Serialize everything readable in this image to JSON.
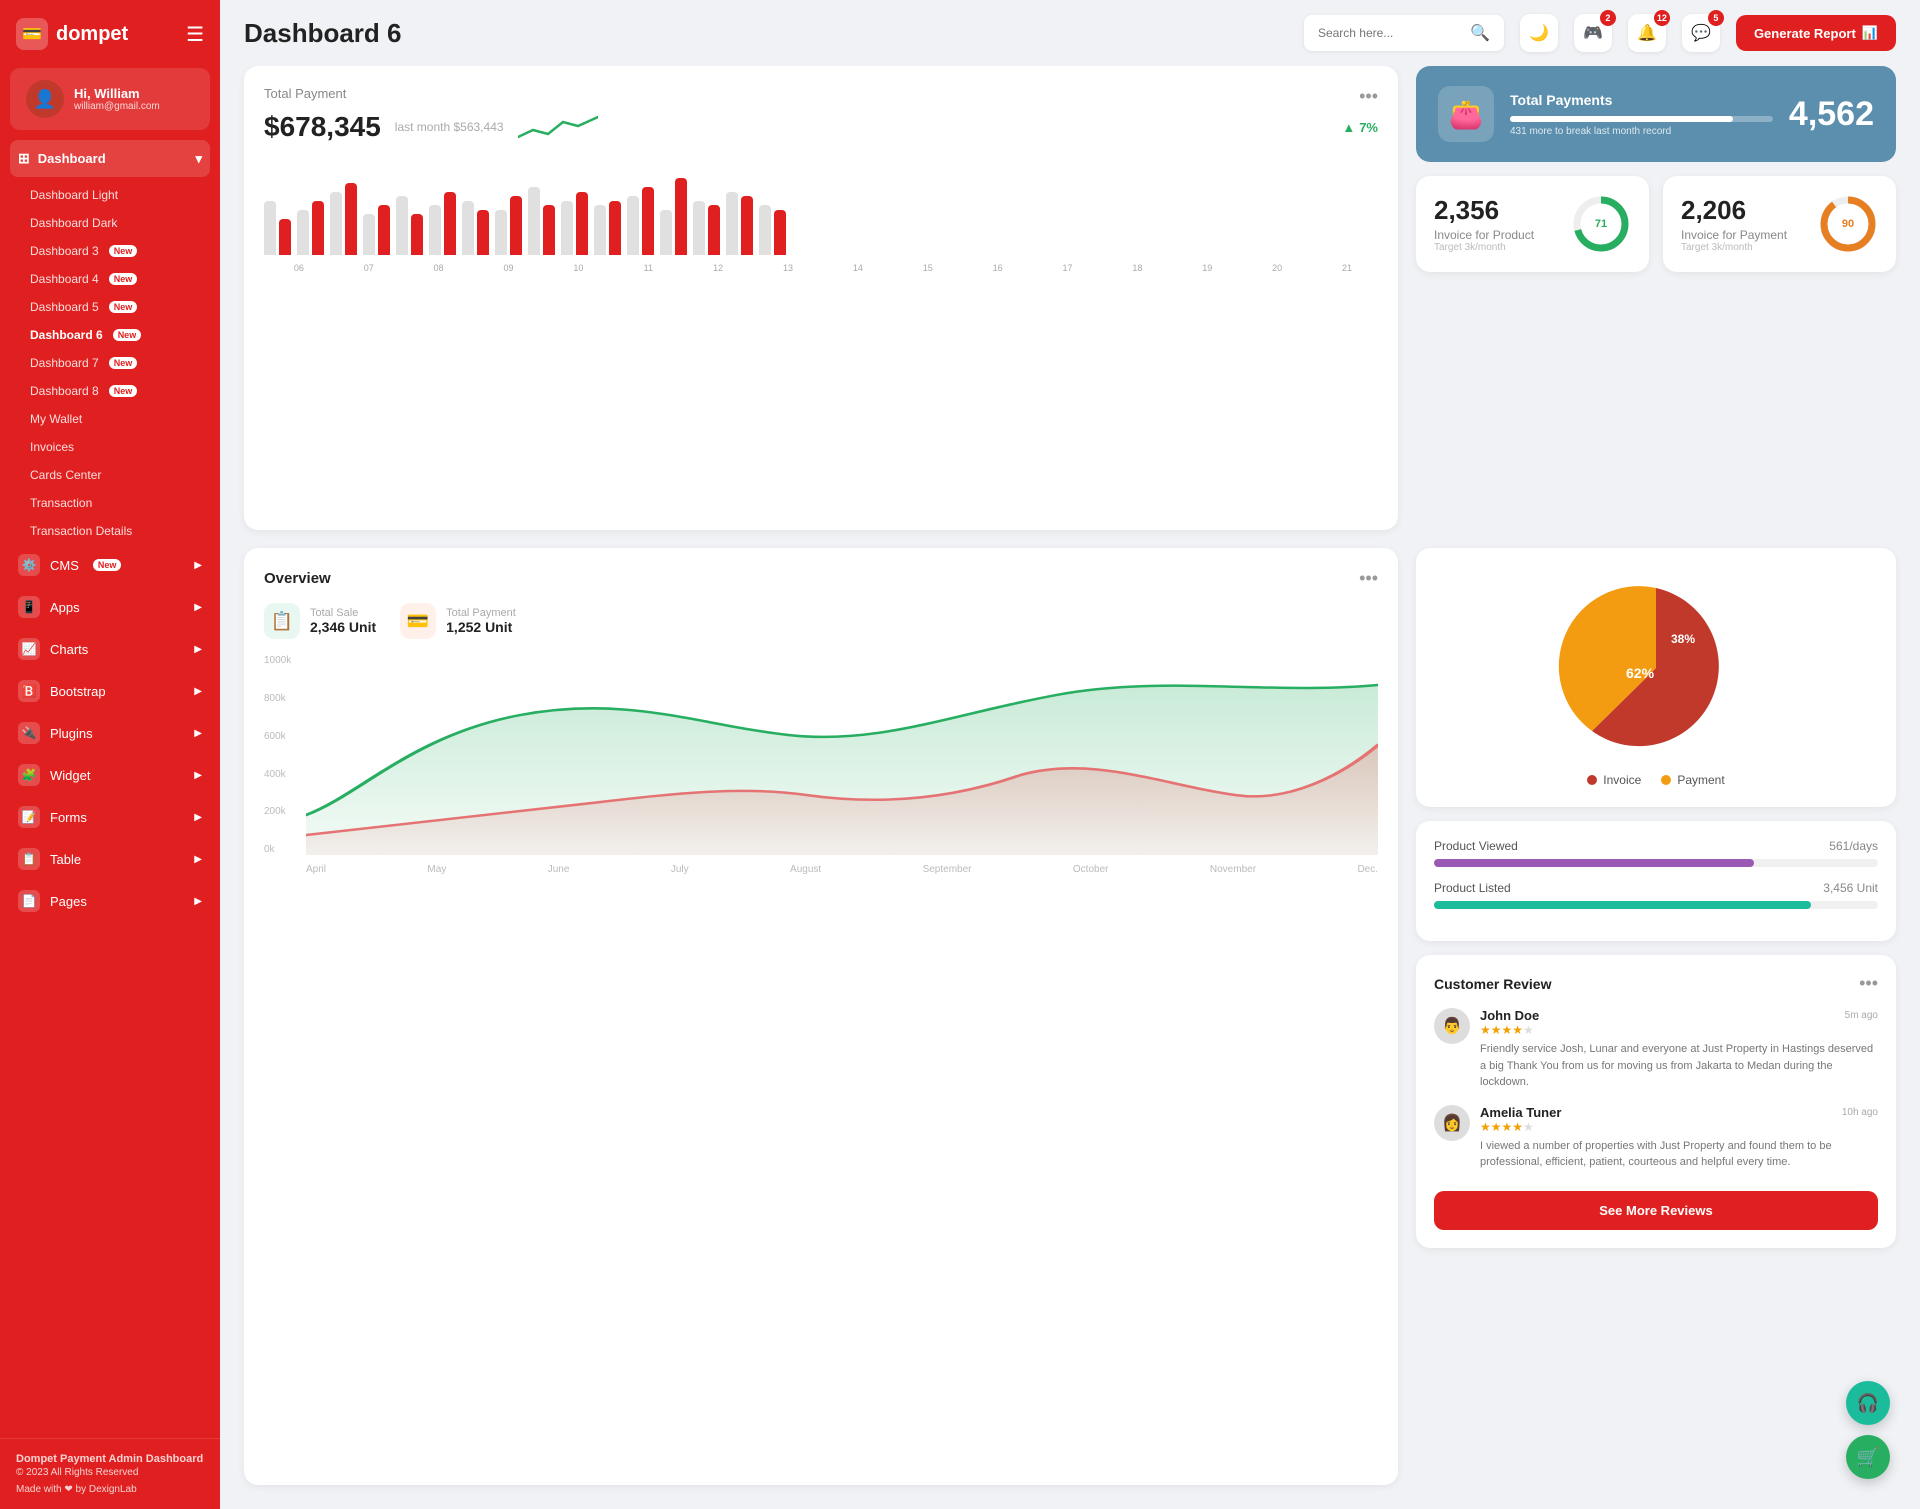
{
  "sidebar": {
    "logo_text": "dompet",
    "user": {
      "greeting": "Hi, William",
      "email": "william@gmail.com"
    },
    "dashboard_group": "Dashboard",
    "dashboard_items": [
      {
        "label": "Dashboard Light",
        "badge": null,
        "active": false
      },
      {
        "label": "Dashboard Dark",
        "badge": null,
        "active": false
      },
      {
        "label": "Dashboard 3",
        "badge": "New",
        "active": false
      },
      {
        "label": "Dashboard 4",
        "badge": "New",
        "active": false
      },
      {
        "label": "Dashboard 5",
        "badge": "New",
        "active": false
      },
      {
        "label": "Dashboard 6",
        "badge": "New",
        "active": true
      },
      {
        "label": "Dashboard 7",
        "badge": "New",
        "active": false
      },
      {
        "label": "Dashboard 8",
        "badge": "New",
        "active": false
      },
      {
        "label": "My Wallet",
        "badge": null,
        "active": false
      },
      {
        "label": "Invoices",
        "badge": null,
        "active": false
      },
      {
        "label": "Cards Center",
        "badge": null,
        "active": false
      },
      {
        "label": "Transaction",
        "badge": null,
        "active": false
      },
      {
        "label": "Transaction Details",
        "badge": null,
        "active": false
      }
    ],
    "nav_items": [
      {
        "label": "CMS",
        "badge": "New",
        "has_arrow": true
      },
      {
        "label": "Apps",
        "badge": null,
        "has_arrow": true
      },
      {
        "label": "Charts",
        "badge": null,
        "has_arrow": true
      },
      {
        "label": "Bootstrap",
        "badge": null,
        "has_arrow": true
      },
      {
        "label": "Plugins",
        "badge": null,
        "has_arrow": true
      },
      {
        "label": "Widget",
        "badge": null,
        "has_arrow": true
      },
      {
        "label": "Forms",
        "badge": null,
        "has_arrow": true
      },
      {
        "label": "Table",
        "badge": null,
        "has_arrow": true
      },
      {
        "label": "Pages",
        "badge": null,
        "has_arrow": true
      }
    ],
    "footer": {
      "brand": "Dompet Payment Admin Dashboard",
      "copyright": "© 2023 All Rights Reserved",
      "made_with": "Made with ❤ by DexignLab"
    }
  },
  "header": {
    "page_title": "Dashboard 6",
    "search_placeholder": "Search here...",
    "notifications": [
      {
        "icon": "controller",
        "count": 2
      },
      {
        "icon": "bell",
        "count": 12
      },
      {
        "icon": "chat",
        "count": 5
      }
    ],
    "generate_btn": "Generate Report"
  },
  "total_payment": {
    "title": "Total Payment",
    "amount": "$678,345",
    "last_month_label": "last month $563,443",
    "trend": "7%",
    "bars": [
      {
        "gray": 60,
        "red": 40
      },
      {
        "gray": 50,
        "red": 60
      },
      {
        "gray": 70,
        "red": 80
      },
      {
        "gray": 45,
        "red": 55
      },
      {
        "gray": 65,
        "red": 45
      },
      {
        "gray": 55,
        "red": 70
      },
      {
        "gray": 60,
        "red": 50
      },
      {
        "gray": 50,
        "red": 65
      },
      {
        "gray": 75,
        "red": 55
      },
      {
        "gray": 60,
        "red": 70
      },
      {
        "gray": 55,
        "red": 60
      },
      {
        "gray": 65,
        "red": 75
      },
      {
        "gray": 50,
        "red": 85
      },
      {
        "gray": 60,
        "red": 55
      },
      {
        "gray": 70,
        "red": 65
      },
      {
        "gray": 55,
        "red": 50
      }
    ],
    "x_labels": [
      "06",
      "07",
      "08",
      "09",
      "10",
      "11",
      "12",
      "13",
      "14",
      "15",
      "16",
      "17",
      "18",
      "19",
      "20",
      "21"
    ]
  },
  "total_payments_blue": {
    "title": "Total Payments",
    "sub": "431 more to break last month record",
    "value": "4,562"
  },
  "invoice_product": {
    "value": "2,356",
    "label": "Invoice for Product",
    "target": "Target 3k/month",
    "percent": 71,
    "color": "#27ae60"
  },
  "invoice_payment": {
    "value": "2,206",
    "label": "Invoice for Payment",
    "target": "Target 3k/month",
    "percent": 90,
    "color": "#e67e22"
  },
  "overview": {
    "title": "Overview",
    "total_sale": {
      "label": "Total Sale",
      "value": "2,346 Unit"
    },
    "total_payment": {
      "label": "Total Payment",
      "value": "1,252 Unit"
    },
    "y_labels": [
      "1000k",
      "800k",
      "600k",
      "400k",
      "200k",
      "0k"
    ],
    "x_labels": [
      "April",
      "May",
      "June",
      "July",
      "August",
      "September",
      "October",
      "November",
      "Dec."
    ]
  },
  "pie_chart": {
    "invoice_pct": 62,
    "payment_pct": 38,
    "legend": [
      {
        "label": "Invoice",
        "color": "#c0392b"
      },
      {
        "label": "Payment",
        "color": "#f39c12"
      }
    ]
  },
  "product_stats": {
    "items": [
      {
        "label": "Product Viewed",
        "value": "561/days",
        "progress": 72,
        "color": "#9b59b6"
      },
      {
        "label": "Product Listed",
        "value": "3,456 Unit",
        "progress": 85,
        "color": "#1abc9c"
      }
    ]
  },
  "customer_review": {
    "title": "Customer Review",
    "reviews": [
      {
        "name": "John Doe",
        "stars": 4,
        "time": "5m ago",
        "text": "Friendly service Josh, Lunar and everyone at Just Property in Hastings deserved a big Thank You from us for moving us from Jakarta to Medan during the lockdown."
      },
      {
        "name": "Amelia Tuner",
        "stars": 4,
        "time": "10h ago",
        "text": "I viewed a number of properties with Just Property and found them to be professional, efficient, patient, courteous and helpful every time."
      }
    ],
    "see_more": "See More Reviews"
  }
}
